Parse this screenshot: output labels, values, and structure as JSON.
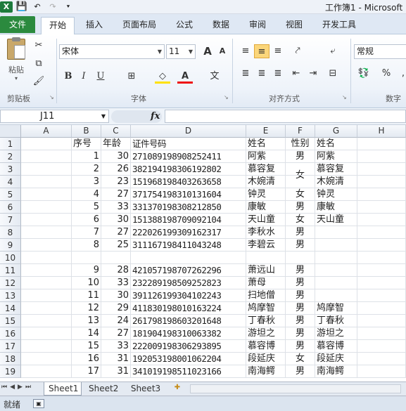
{
  "window": {
    "title": "工作簿1 - Microsoft"
  },
  "qat": {
    "app_icon": "X",
    "save_icon": "💾",
    "undo": "↶",
    "redo": "↷",
    "customize": "⯆"
  },
  "ribbon_tabs": [
    "文件",
    "开始",
    "插入",
    "页面布局",
    "公式",
    "数据",
    "审阅",
    "视图",
    "开发工具"
  ],
  "ribbon": {
    "clipboard": {
      "paste": "粘贴",
      "group": "剪贴板"
    },
    "font": {
      "name": "宋体",
      "size": "11",
      "grow": "A",
      "shrink": "A",
      "bold": "B",
      "italic": "I",
      "underline": "U",
      "border": "⊞",
      "fill": "◇",
      "font_color": "A",
      "phonetic": "文",
      "group": "字体"
    },
    "alignment": {
      "group": "对齐方式"
    },
    "number": {
      "format": "常规",
      "percent": "%",
      "group": "数字"
    }
  },
  "formula_bar": {
    "name_box": "J11",
    "fx": "fx",
    "value": ""
  },
  "columns": [
    "A",
    "B",
    "C",
    "D",
    "E",
    "F",
    "G",
    "H"
  ],
  "rows": [
    {
      "n": "1",
      "B": "序号",
      "C": "年龄",
      "D": "证件号码",
      "E": "姓名",
      "F": "性别",
      "G": "姓名"
    },
    {
      "n": "2",
      "B": "1",
      "C": "30",
      "D": "271089198908252411",
      "E": "阿紫",
      "F": "男",
      "G": "阿紫"
    },
    {
      "n": "3",
      "B": "2",
      "C": "26",
      "D": "382194198306192802",
      "E": "慕容复",
      "F": "",
      "G": "慕容复"
    },
    {
      "n": "4",
      "B": "3",
      "C": "23",
      "D": "151968198403263658",
      "E": "木婉清",
      "F": "",
      "G": "木婉清"
    },
    {
      "n": "5",
      "B": "4",
      "C": "27",
      "D": "371754198310131604",
      "E": "钟灵",
      "F": "女",
      "G": "钟灵"
    },
    {
      "n": "6",
      "B": "5",
      "C": "33",
      "D": "331370198308212850",
      "E": "康敏",
      "F": "男",
      "G": "康敏"
    },
    {
      "n": "7",
      "B": "6",
      "C": "30",
      "D": "151388198709092104",
      "E": "天山童",
      "F": "女",
      "G": "天山童"
    },
    {
      "n": "8",
      "B": "7",
      "C": "27",
      "D": "222026199309162317",
      "E": "李秋水",
      "F": "男",
      "G": ""
    },
    {
      "n": "9",
      "B": "8",
      "C": "25",
      "D": "311167198411043248",
      "E": "李碧云",
      "F": "男",
      "G": ""
    },
    {
      "n": "10",
      "B": "",
      "C": "",
      "D": "",
      "E": "",
      "F": "",
      "G": ""
    },
    {
      "n": "11",
      "B": "9",
      "C": "28",
      "D": "421057198707262296",
      "E": "萧远山",
      "F": "男",
      "G": ""
    },
    {
      "n": "12",
      "B": "10",
      "C": "33",
      "D": "232289198509252823",
      "E": "萧母",
      "F": "男",
      "G": ""
    },
    {
      "n": "13",
      "B": "11",
      "C": "30",
      "D": "391126199304102243",
      "E": "扫地僧",
      "F": "男",
      "G": ""
    },
    {
      "n": "14",
      "B": "12",
      "C": "29",
      "D": "411830198010163224",
      "E": "鸠摩智",
      "F": "男",
      "G": "鸠摩智"
    },
    {
      "n": "15",
      "B": "13",
      "C": "24",
      "D": "261798198603201648",
      "E": "丁春秋",
      "F": "男",
      "G": "丁春秋"
    },
    {
      "n": "16",
      "B": "14",
      "C": "27",
      "D": "181904198310063382",
      "E": "游坦之",
      "F": "男",
      "G": "游坦之"
    },
    {
      "n": "17",
      "B": "15",
      "C": "33",
      "D": "222009198306293895",
      "E": "慕容博",
      "F": "男",
      "G": "慕容博"
    },
    {
      "n": "18",
      "B": "16",
      "C": "31",
      "D": "192053198001062204",
      "E": "段延庆",
      "F": "女",
      "G": "段延庆"
    },
    {
      "n": "19",
      "B": "17",
      "C": "31",
      "D": "341019198511023166",
      "E": "南海鳄",
      "F": "男",
      "G": "南海鳄"
    }
  ],
  "merged_F3_F4": "女",
  "sheets": [
    "Sheet1",
    "Sheet2",
    "Sheet3"
  ],
  "status": {
    "ready": "就绪"
  }
}
